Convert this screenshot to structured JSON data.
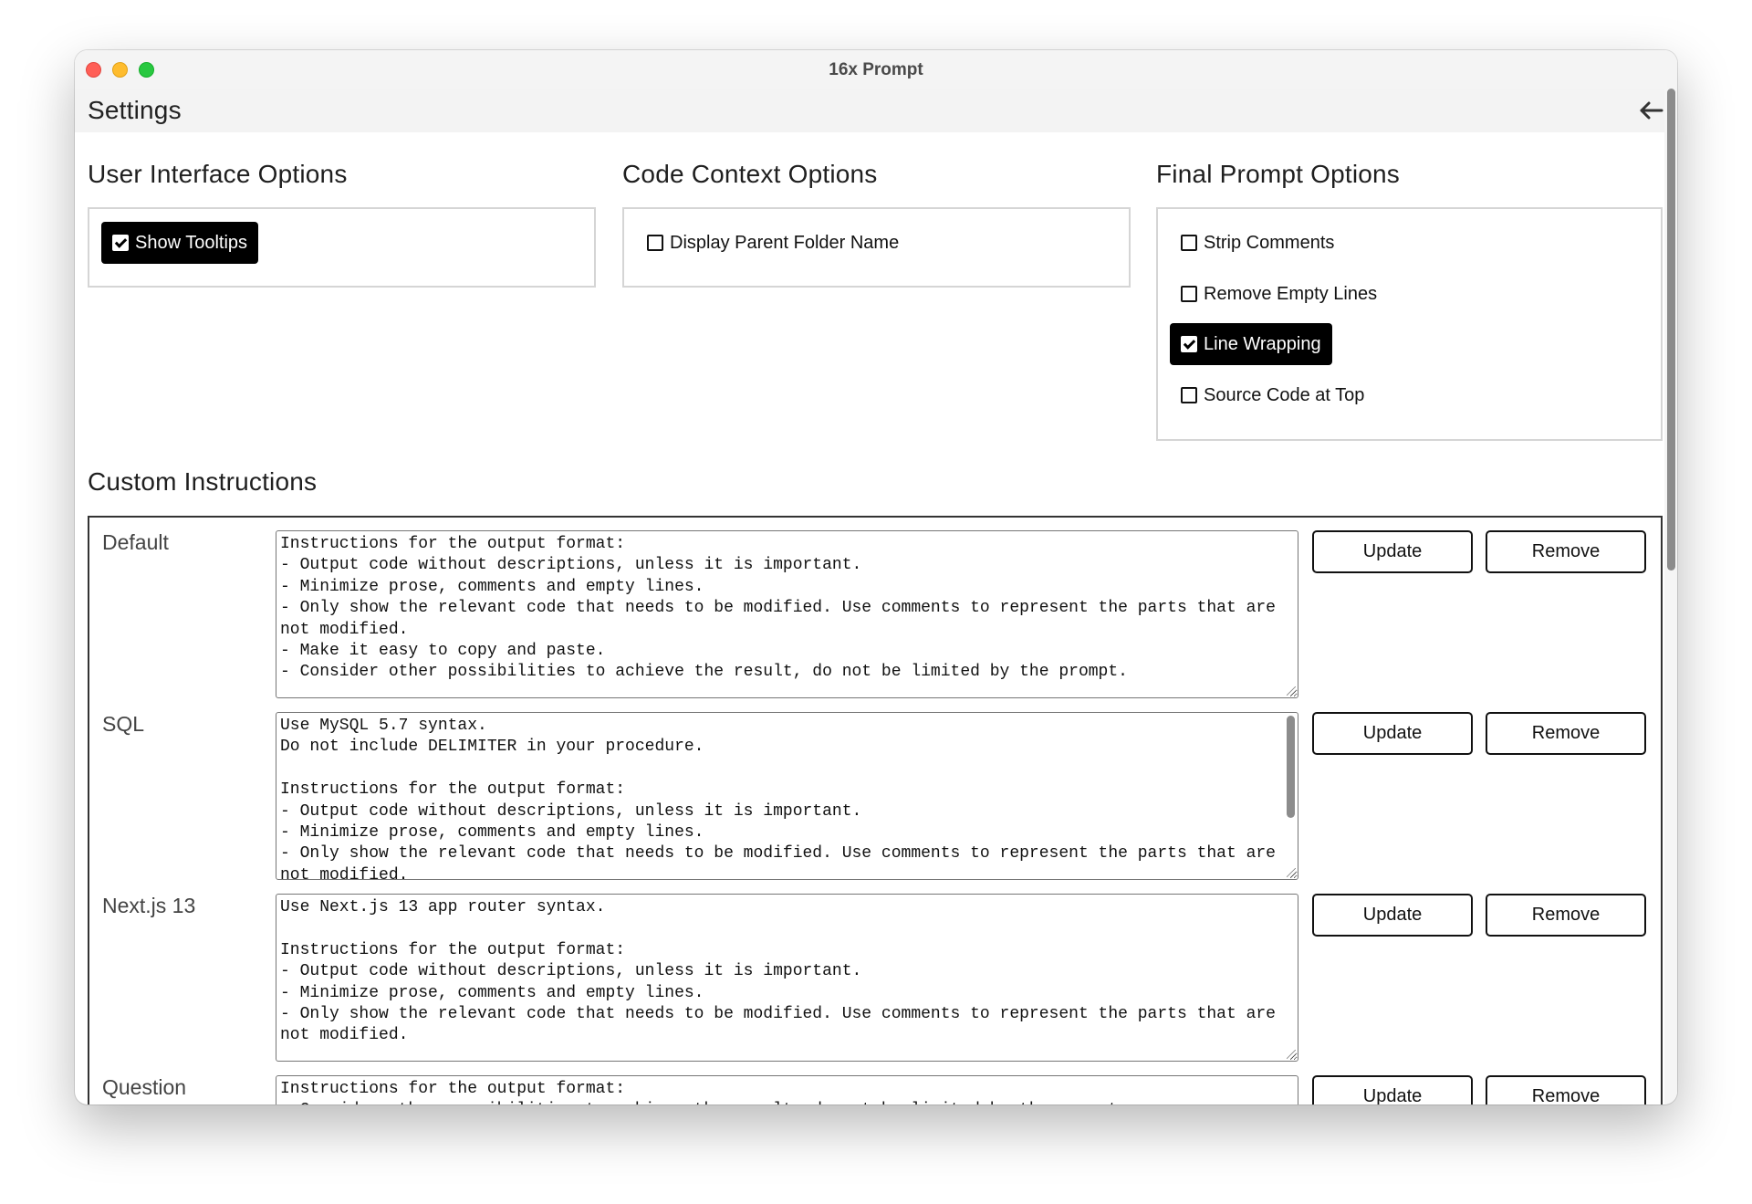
{
  "window": {
    "title": "16x Prompt"
  },
  "header": {
    "title": "Settings",
    "back_icon": "arrow-left-icon"
  },
  "user_interface_options": {
    "heading": "User Interface Options",
    "options": [
      {
        "label": "Show Tooltips",
        "checked": true
      }
    ]
  },
  "code_context_options": {
    "heading": "Code Context Options",
    "options": [
      {
        "label": "Display Parent Folder Name",
        "checked": false
      }
    ]
  },
  "final_prompt_options": {
    "heading": "Final Prompt Options",
    "options": [
      {
        "label": "Strip Comments",
        "checked": false
      },
      {
        "label": "Remove Empty Lines",
        "checked": false
      },
      {
        "label": "Line Wrapping",
        "checked": true
      },
      {
        "label": "Source Code at Top",
        "checked": false
      }
    ]
  },
  "custom_instructions": {
    "heading": "Custom Instructions",
    "update_label": "Update",
    "remove_label": "Remove",
    "items": [
      {
        "name": "Default",
        "text": "Instructions for the output format:\n- Output code without descriptions, unless it is important.\n- Minimize prose, comments and empty lines.\n- Only show the relevant code that needs to be modified. Use comments to represent the parts that are not modified.\n- Make it easy to copy and paste.\n- Consider other possibilities to achieve the result, do not be limited by the prompt."
      },
      {
        "name": "SQL",
        "text": "Use MySQL 5.7 syntax.\nDo not include DELIMITER in your procedure.\n\nInstructions for the output format:\n- Output code without descriptions, unless it is important.\n- Minimize prose, comments and empty lines.\n- Only show the relevant code that needs to be modified. Use comments to represent the parts that are not modified."
      },
      {
        "name": "Next.js 13",
        "text": "Use Next.js 13 app router syntax.\n\nInstructions for the output format:\n- Output code without descriptions, unless it is important.\n- Minimize prose, comments and empty lines.\n- Only show the relevant code that needs to be modified. Use comments to represent the parts that are not modified."
      },
      {
        "name": "Question",
        "text": "Instructions for the output format:\n- Consider other possibilities to achieve the result, do not be limited by the prompt."
      }
    ]
  }
}
